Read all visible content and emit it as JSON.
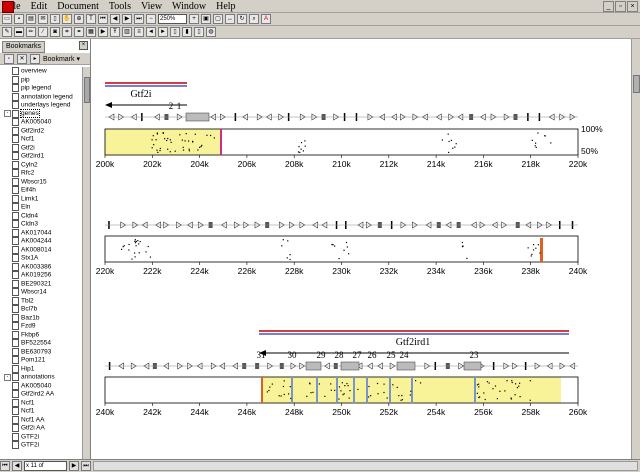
{
  "menu": [
    "File",
    "Edit",
    "Document",
    "Tools",
    "View",
    "Window",
    "Help"
  ],
  "toolbar": {
    "zoom": "250%"
  },
  "sidebar": {
    "tab_label": "Bookmarks",
    "options_label": "Bookmark",
    "items": [
      {
        "label": "overview",
        "level": 1
      },
      {
        "label": "pip",
        "level": 1
      },
      {
        "label": "pip legend",
        "level": 1
      },
      {
        "label": "annotation legend",
        "level": 1
      },
      {
        "label": "underlays legend",
        "level": 1
      },
      {
        "label": "genes",
        "level": 0,
        "expander": "-"
      },
      {
        "label": "AK005040",
        "level": 1
      },
      {
        "label": "Gtf2ird2",
        "level": 1
      },
      {
        "label": "Ncf1",
        "level": 1
      },
      {
        "label": "Gtf2i",
        "level": 1
      },
      {
        "label": "Gtf2ird1",
        "level": 1
      },
      {
        "label": "Cyln2",
        "level": 1
      },
      {
        "label": "Rfc2",
        "level": 1
      },
      {
        "label": "Wbscr15",
        "level": 1
      },
      {
        "label": "Eif4h",
        "level": 1
      },
      {
        "label": "Limk1",
        "level": 1
      },
      {
        "label": "Eln",
        "level": 1
      },
      {
        "label": "Cldn4",
        "level": 1
      },
      {
        "label": "Cldn3",
        "level": 1
      },
      {
        "label": "AK017044",
        "level": 1
      },
      {
        "label": "AK004244",
        "level": 1
      },
      {
        "label": "AK008014",
        "level": 1
      },
      {
        "label": "Stx1A",
        "level": 1
      },
      {
        "label": "AK003386",
        "level": 1
      },
      {
        "label": "AK019256",
        "level": 1
      },
      {
        "label": "BE290321",
        "level": 1
      },
      {
        "label": "Wbscr14",
        "level": 1
      },
      {
        "label": "Tbl2",
        "level": 1
      },
      {
        "label": "Bcl7b",
        "level": 1
      },
      {
        "label": "Baz1b",
        "level": 1
      },
      {
        "label": "Fzd9",
        "level": 1
      },
      {
        "label": "Fkbp6",
        "level": 1
      },
      {
        "label": "BF522554",
        "level": 1
      },
      {
        "label": "BE630793",
        "level": 1
      },
      {
        "label": "Pom121",
        "level": 1
      },
      {
        "label": "Hip1",
        "level": 1
      },
      {
        "label": "annotations",
        "level": 0,
        "expander": "-"
      },
      {
        "label": "AK005040",
        "level": 1
      },
      {
        "label": "Gtf2ird2 AA",
        "level": 1
      },
      {
        "label": "Ncf1",
        "level": 1
      },
      {
        "label": "Ncf1",
        "level": 1
      },
      {
        "label": "Ncf1 AA",
        "level": 1
      },
      {
        "label": "Gtf2i AA",
        "level": 1
      },
      {
        "label": "GTF2i",
        "level": 1
      },
      {
        "label": "GTF2i",
        "level": 1
      }
    ]
  },
  "status": {
    "page": "x 11 of"
  },
  "tracks": [
    {
      "axis": [
        "200k",
        "202k",
        "204k",
        "206k",
        "208k",
        "210k",
        "212k",
        "214k",
        "216k",
        "218k",
        "220k"
      ],
      "pct_labels": [
        "100%",
        "50%"
      ],
      "gene": {
        "name": "Gtf2i"
      },
      "exon_labels": [
        "2",
        "1"
      ]
    },
    {
      "axis": [
        "220k",
        "222k",
        "224k",
        "226k",
        "228k",
        "230k",
        "232k",
        "234k",
        "236k",
        "238k",
        "240k"
      ]
    },
    {
      "axis": [
        "240k",
        "242k",
        "244k",
        "246k",
        "248k",
        "250k",
        "252k",
        "254k",
        "256k",
        "258k",
        "260k"
      ],
      "gene": {
        "name": "Gtf2ird1"
      },
      "exon_labels": [
        "31",
        "30",
        "29",
        "28",
        "27",
        "26",
        "25",
        "24",
        "23"
      ]
    }
  ],
  "colors": {
    "yellow": "#f8f398",
    "magenta": "#d02c8c",
    "orange": "#e06020",
    "blue": "#7896c8",
    "gene_red": "#d04040",
    "gene_blue": "#5050c0"
  }
}
